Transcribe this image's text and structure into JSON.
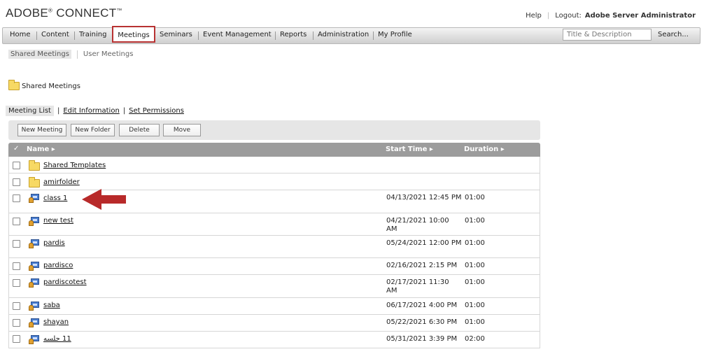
{
  "brand": {
    "name": "ADOBE",
    "reg": "®",
    "product": "CONNECT",
    "tm": "™"
  },
  "header": {
    "help": "Help",
    "logout": "Logout:",
    "user": "Adobe Server Administrator"
  },
  "nav": {
    "items": [
      "Home",
      "Content",
      "Training",
      "Meetings",
      "Seminars",
      "Event Management",
      "Reports",
      "Administration",
      "My Profile"
    ],
    "active": "Meetings",
    "search_placeholder": "Title & Description",
    "search_button": "Search..."
  },
  "subnav": {
    "items": [
      "Shared Meetings",
      "User Meetings"
    ],
    "active": "Shared Meetings"
  },
  "folder": {
    "title": "Shared Meetings"
  },
  "tabs": {
    "items": [
      "Meeting List",
      "Edit Information",
      "Set Permissions"
    ],
    "active": "Meeting List"
  },
  "toolbar": {
    "buttons": [
      "New Meeting",
      "New Folder",
      "Delete",
      "Move"
    ]
  },
  "table": {
    "headers": {
      "name": "Name",
      "start": "Start Time",
      "duration": "Duration"
    },
    "rows": [
      {
        "type": "folder",
        "name": "Shared Templates",
        "start": "",
        "duration": ""
      },
      {
        "type": "folder",
        "name": "amirfolder",
        "start": "",
        "duration": ""
      },
      {
        "type": "meeting",
        "name": "class 1",
        "start": "04/13/2021 12:45 PM",
        "duration": "01:00"
      },
      {
        "type": "meeting",
        "name": "new test",
        "start": "04/21/2021 10:00 AM",
        "duration": "01:00"
      },
      {
        "type": "meeting",
        "name": "pardis",
        "start": "05/24/2021 12:00 PM",
        "duration": "01:00"
      },
      {
        "type": "meeting",
        "name": "pardisco",
        "start": "02/16/2021 2:15 PM",
        "duration": "01:00"
      },
      {
        "type": "meeting",
        "name": "pardiscotest",
        "start": "02/17/2021 11:30 AM",
        "duration": "01:00"
      },
      {
        "type": "meeting",
        "name": "saba",
        "start": "06/17/2021 4:00 PM",
        "duration": "01:00"
      },
      {
        "type": "meeting",
        "name": "shayan",
        "start": "05/22/2021 6:30 PM",
        "duration": "01:00"
      },
      {
        "type": "meeting",
        "name": "‫11 جلسه‬",
        "start": "05/31/2021 3:39 PM",
        "duration": "02:00"
      }
    ]
  },
  "annotation": {
    "arrow_color": "#b82a2a"
  }
}
